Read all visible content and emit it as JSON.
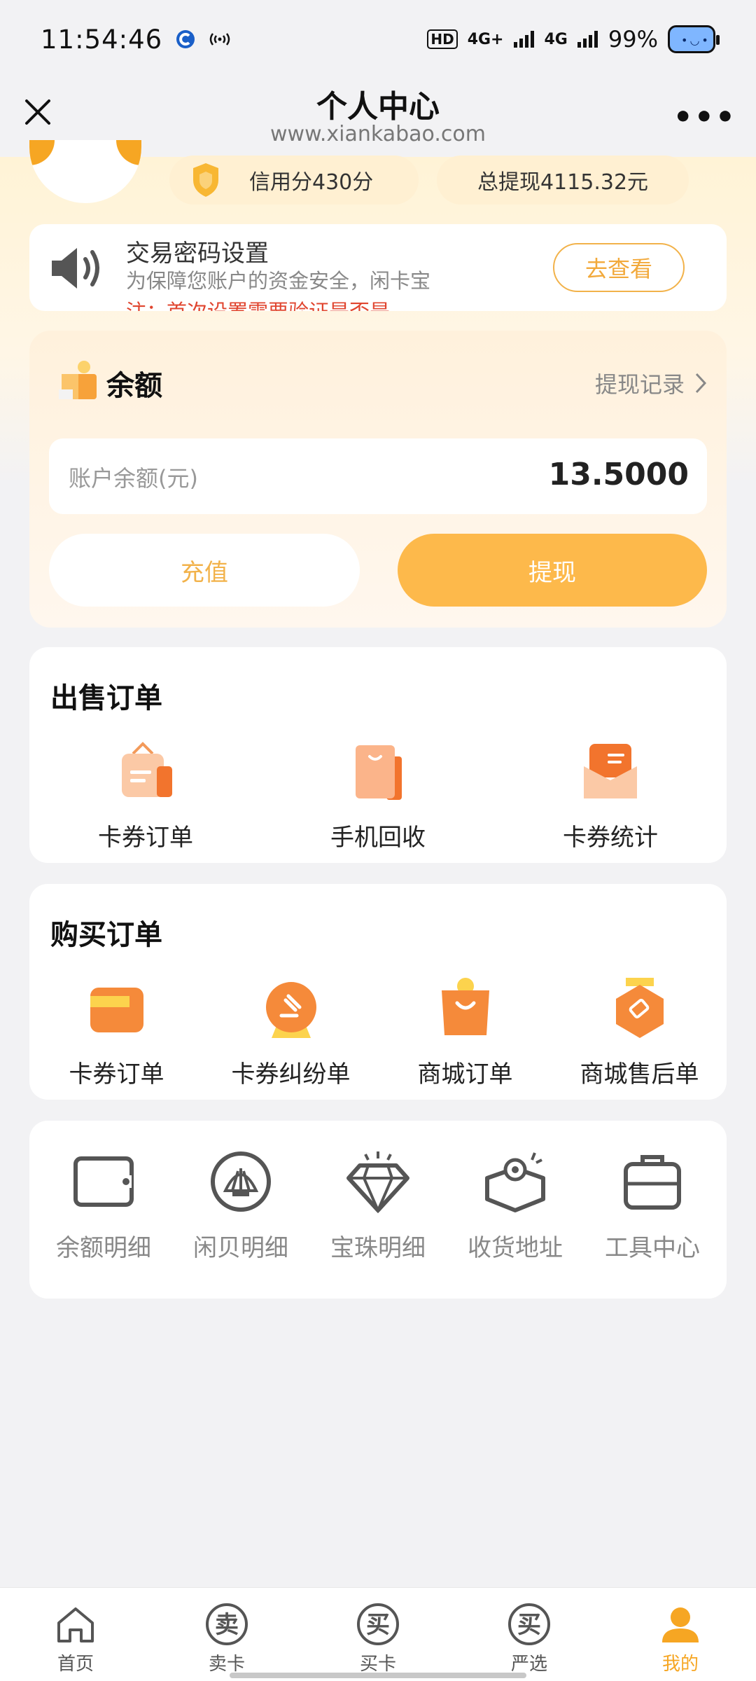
{
  "statusbar": {
    "time": "11:54:46",
    "hd_label": "HD",
    "sim1": "4G+",
    "sim2": "4G",
    "battery": "99%"
  },
  "navbar": {
    "title": "个人中心",
    "url": "www.xiankabao.com"
  },
  "profile": {
    "credit": "信用分430分",
    "total_withdraw": "总提现4115.32元"
  },
  "notice": {
    "title": "交易密码设置",
    "desc": "为保障您账户的资金安全，闲卡宝",
    "warning": "注：首次设置需要验证是否是",
    "button": "去查看"
  },
  "balance": {
    "title": "余额",
    "record_link": "提现记录",
    "account_label": "账户余额(元)",
    "account_value": "13.5000",
    "recharge": "充值",
    "withdraw": "提现"
  },
  "sell_orders": {
    "title": "出售订单",
    "items": [
      {
        "label": "卡券订单",
        "icon": "card-order-icon"
      },
      {
        "label": "手机回收",
        "icon": "phone-recycle-icon"
      },
      {
        "label": "卡券统计",
        "icon": "card-stats-icon"
      }
    ]
  },
  "buy_orders": {
    "title": "购买订单",
    "items": [
      {
        "label": "卡券订单",
        "icon": "card-icon"
      },
      {
        "label": "卡券纠纷单",
        "icon": "gavel-icon"
      },
      {
        "label": "商城订单",
        "icon": "shopping-bag-icon"
      },
      {
        "label": "商城售后单",
        "icon": "after-sale-icon"
      }
    ]
  },
  "tools": {
    "items": [
      {
        "label": "余额明细",
        "icon": "wallet-icon"
      },
      {
        "label": "闲贝明细",
        "icon": "shell-icon"
      },
      {
        "label": "宝珠明细",
        "icon": "diamond-icon"
      },
      {
        "label": "收货地址",
        "icon": "location-box-icon"
      },
      {
        "label": "工具中心",
        "icon": "toolbox-icon"
      }
    ]
  },
  "tabbar": {
    "items": [
      {
        "label": "首页",
        "glyph": ""
      },
      {
        "label": "卖卡",
        "glyph": "卖"
      },
      {
        "label": "买卡",
        "glyph": "买"
      },
      {
        "label": "严选",
        "glyph": "买"
      },
      {
        "label": "我的",
        "glyph": ""
      }
    ],
    "active_color": "#f6a623"
  },
  "colors": {
    "accent": "#fdb94b",
    "warning_text": "#e0452f"
  }
}
